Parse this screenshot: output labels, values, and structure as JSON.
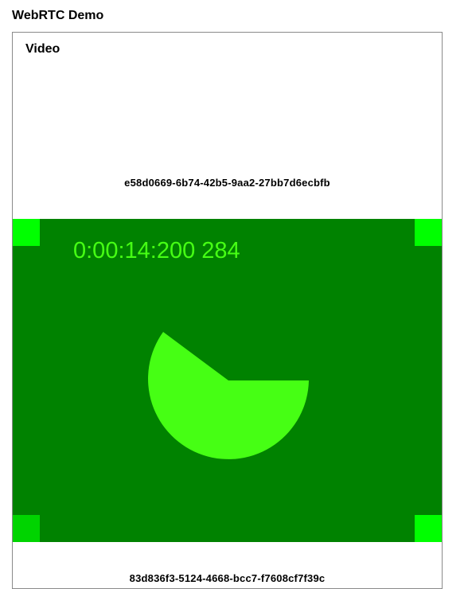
{
  "page": {
    "title": "WebRTC Demo"
  },
  "video_panel": {
    "heading": "Video",
    "local_stream_id": "e58d0669-6b74-42b5-9aa2-27bb7d6ecbfb",
    "remote_stream_id": "83d836f3-5124-4668-bcc7-f7608cf7f39c",
    "timecode": "0:00:14:200 284",
    "colors": {
      "background": "#008200",
      "pie": "#46ff14",
      "corner_bright": "#00ff00",
      "corner_dim": "#00d400"
    }
  }
}
